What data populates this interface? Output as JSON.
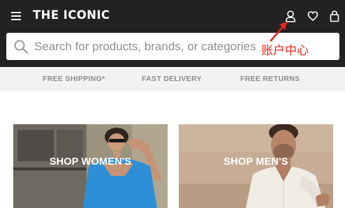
{
  "header": {
    "logo": "THE ICONIC",
    "menu_icon": "hamburger-menu-icon",
    "icons": [
      "user-account-icon",
      "heart-wishlist-icon",
      "shopping-bag-icon"
    ]
  },
  "search": {
    "placeholder": "Search for products, brands, or categories",
    "icon": "search-icon"
  },
  "annotation": {
    "label": "账户中心",
    "color": "#e8241c"
  },
  "usp_bar": {
    "items": [
      {
        "label": "FREE SHIPPING*"
      },
      {
        "label": "FAST DELIVERY"
      },
      {
        "label": "FREE RETURNS"
      }
    ]
  },
  "tiles": [
    {
      "label": "SHOP WOMEN'S"
    },
    {
      "label": "SHOP MEN'S"
    }
  ],
  "colors": {
    "header_bg": "#222222",
    "usp_bg": "#f2f2f2",
    "usp_text": "#8a8a8a",
    "placeholder": "#8e8e8e"
  }
}
